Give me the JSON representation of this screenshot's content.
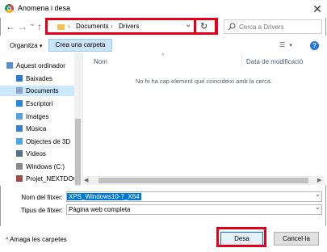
{
  "window": {
    "title": "Anomena i desa",
    "close_glyph": "✕"
  },
  "nav": {
    "back_glyph": "←",
    "forward_glyph": "→",
    "up_glyph": "↑",
    "recent_glyph": "⌄",
    "breadcrumbs": [
      "Documents",
      "Drivers"
    ],
    "separator": "›",
    "expand_glyph": "⌄",
    "refresh_glyph": "↻",
    "search_placeholder": "Cerca a Drivers"
  },
  "toolbar": {
    "organize_label": "Organitza",
    "organize_caret": "▾",
    "new_folder_label": "Crea una carpeta",
    "view_glyph": "☰",
    "view_caret": "▾",
    "help_glyph": "?"
  },
  "sidebar": {
    "items": [
      {
        "label": "Aquest ordinador",
        "icon": "computer-icon",
        "color": "#5a8fd0"
      },
      {
        "label": "Baixades",
        "icon": "downloads-icon",
        "color": "#2e7bcf"
      },
      {
        "label": "Documents",
        "icon": "documents-icon",
        "color": "#8aa4c8",
        "selected": true
      },
      {
        "label": "Escriptori",
        "icon": "desktop-icon",
        "color": "#2a86d8"
      },
      {
        "label": "Imatges",
        "icon": "pictures-icon",
        "color": "#5ba3e0"
      },
      {
        "label": "Música",
        "icon": "music-icon",
        "color": "#3a7fd0"
      },
      {
        "label": "Objectes de 3D",
        "icon": "3d-objects-icon",
        "color": "#4fa8e6"
      },
      {
        "label": "Vídeos",
        "icon": "videos-icon",
        "color": "#5a6f8f"
      },
      {
        "label": "Windows  (C:)",
        "icon": "drive-icon",
        "color": "#8a8a8a"
      },
      {
        "label": "Projet_NEXTDOC",
        "icon": "network-drive-icon",
        "color": "#a24a4a"
      }
    ]
  },
  "list": {
    "columns": [
      "Nom",
      "Data de modificació"
    ],
    "sort_glyph": "^",
    "empty_message": "No hi ha cap element que coincideixi amb la cerca."
  },
  "fields": {
    "filename_label": "Nom del fitxer:",
    "filename_value": "XPS_Windows10-7_X64",
    "filetype_label": "Tipus de fitxer:",
    "filetype_value": "Pàgina web completa",
    "dropdown_glyph": "⌄"
  },
  "footer": {
    "hide_folders_label": "Amaga les carpetes",
    "hide_caret": "^",
    "save_label": "Desa",
    "cancel_label": "Cancel·la"
  },
  "colors": {
    "highlight_red": "#e2001a",
    "selection_blue": "#cce8ff",
    "accent": "#0078d7"
  }
}
